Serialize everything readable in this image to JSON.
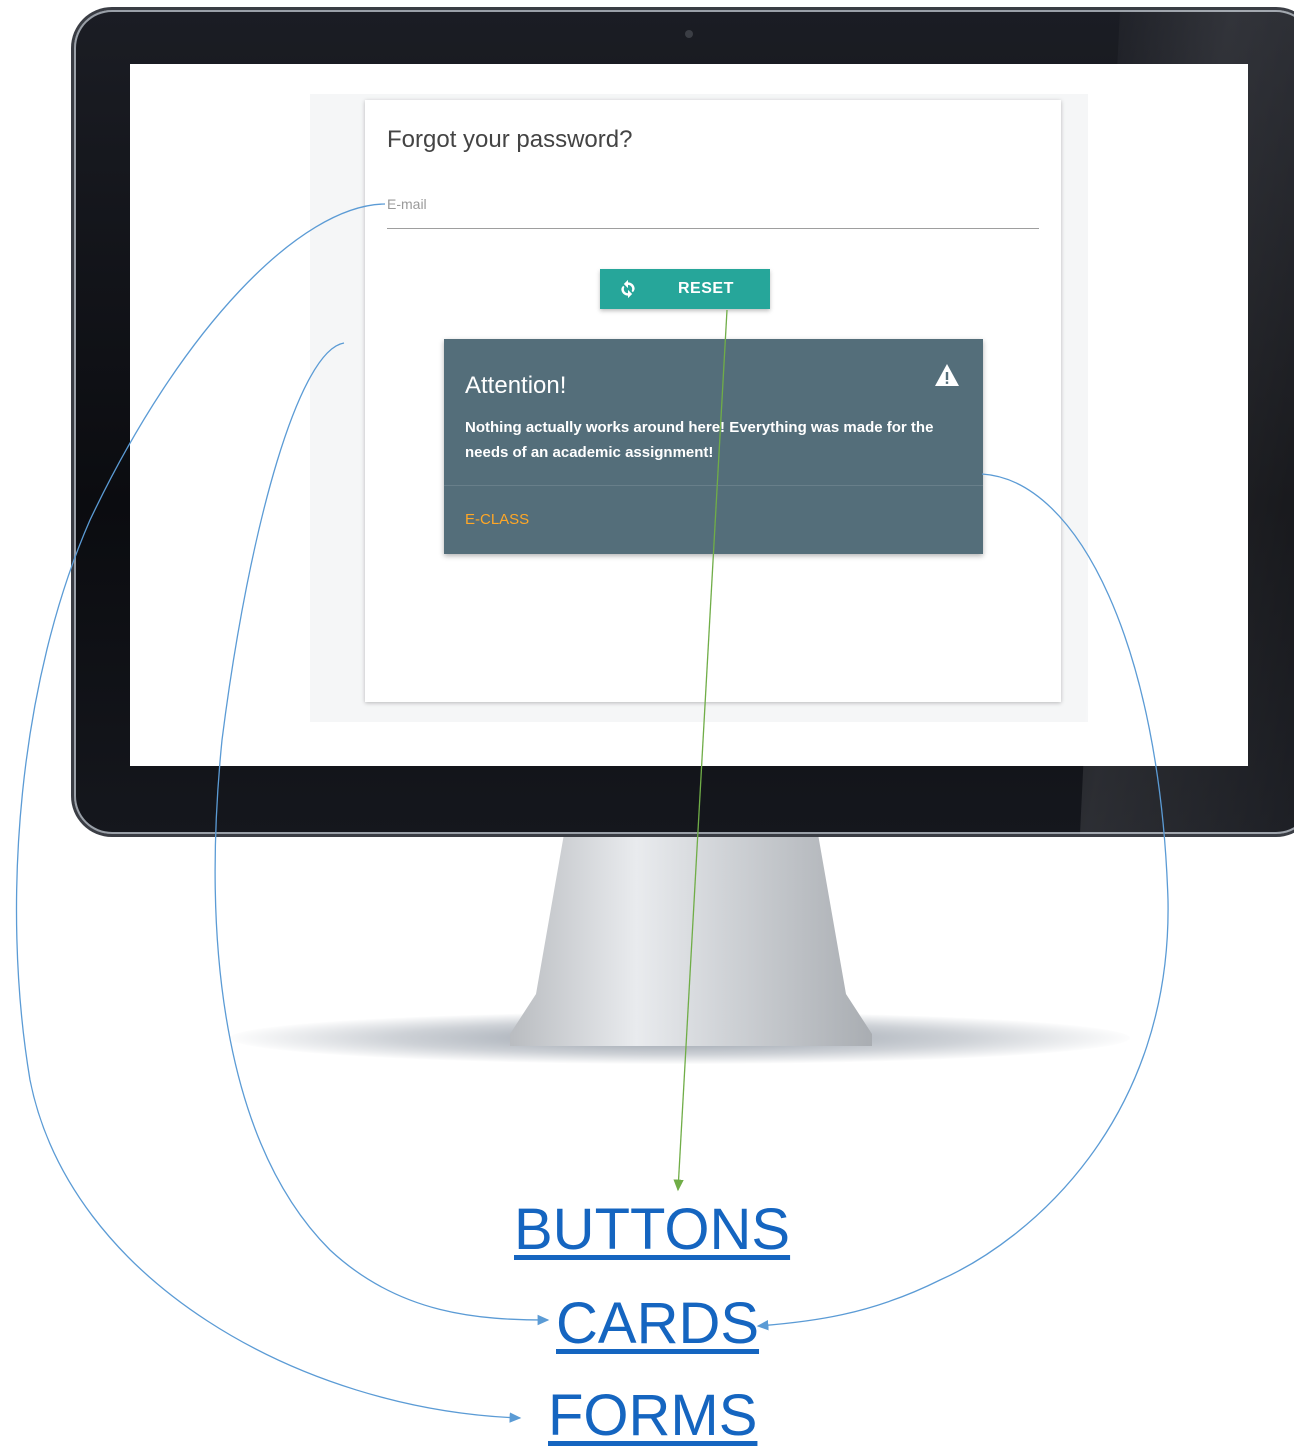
{
  "forgot_form": {
    "title": "Forgot your password?",
    "email_label": "E-mail",
    "reset_button_label": "RESET"
  },
  "alert_card": {
    "title": "Attention!",
    "message": "Nothing actually works around here! Everything was made for the needs of an academic assignment!",
    "link_label": "E-CLASS"
  },
  "annotations": {
    "buttons": "BUTTONS",
    "cards": "CARDS",
    "forms": "FORMS"
  },
  "colors": {
    "reset_button": "#26a69a",
    "alert_card_bg": "#546e7a",
    "link": "#ffa726",
    "annotation_text": "#1565c0",
    "annotation_line_blue": "#5b9bd5",
    "annotation_line_green": "#70ad47"
  }
}
